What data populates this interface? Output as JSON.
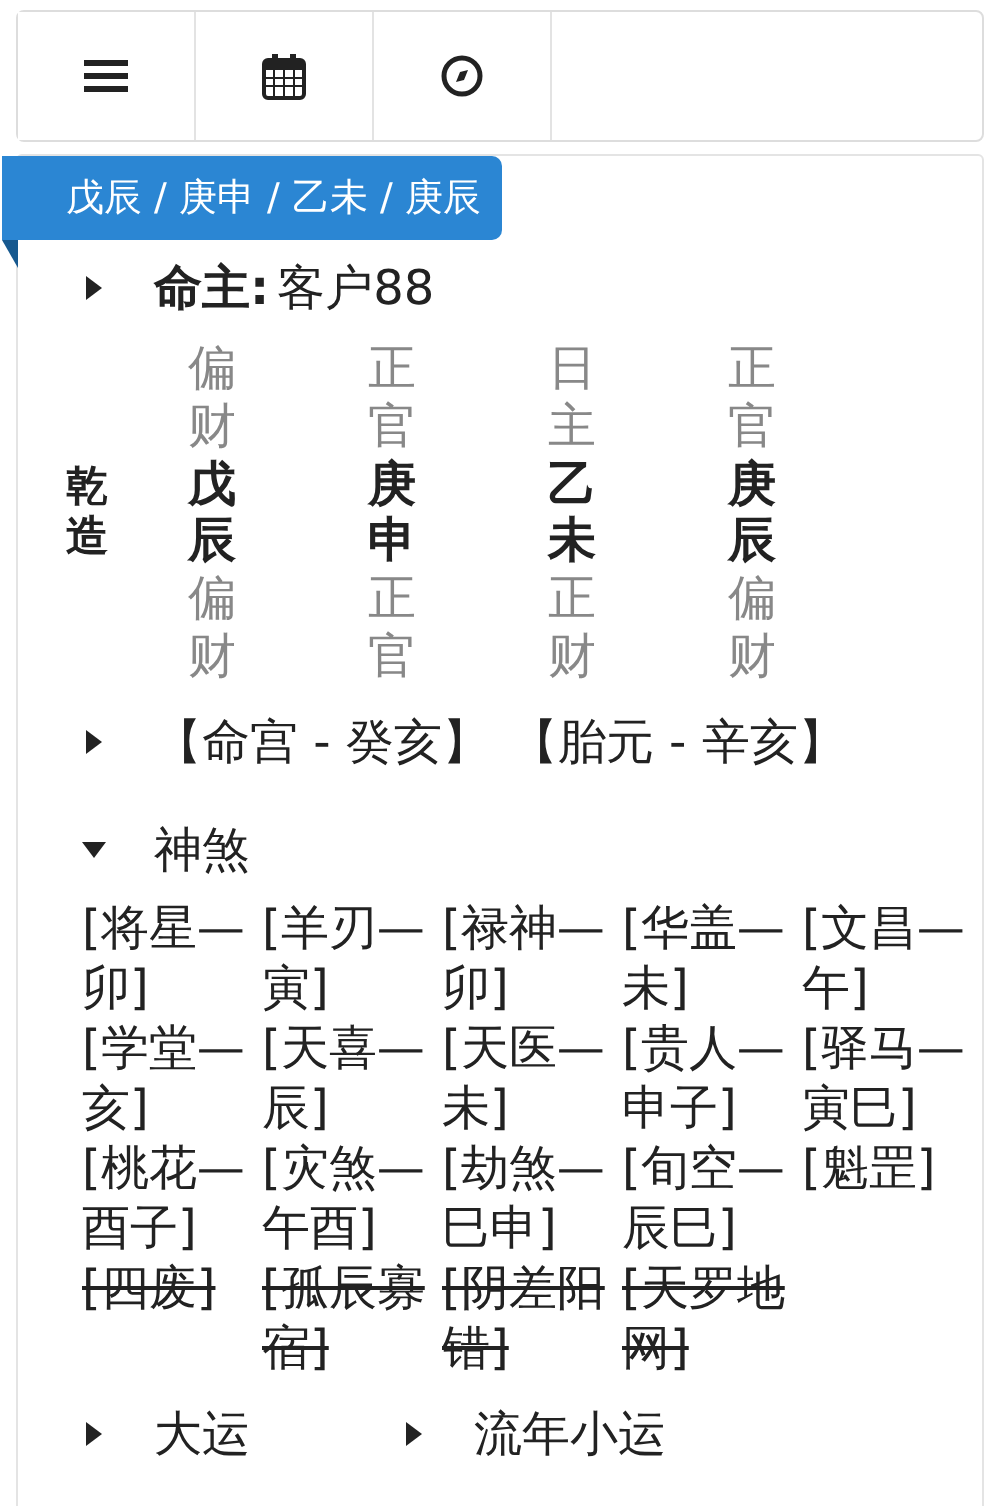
{
  "toolbar": [
    {
      "kind": "menu"
    },
    {
      "kind": "calendar"
    },
    {
      "kind": "compass"
    }
  ],
  "ribbon": "戊辰 / 庚申 / 乙未 / 庚辰",
  "owner": {
    "expanded": false,
    "label": "命主:",
    "value": "客户88"
  },
  "chart": {
    "label": "乾造",
    "pillars": [
      {
        "top": "偏财",
        "stem": "戊",
        "branch": "辰",
        "bottom": "偏财"
      },
      {
        "top": "正官",
        "stem": "庚",
        "branch": "申",
        "bottom": "正官"
      },
      {
        "top": "日主",
        "stem": "乙",
        "branch": "未",
        "bottom": "正财"
      },
      {
        "top": "正官",
        "stem": "庚",
        "branch": "辰",
        "bottom": "偏财"
      }
    ]
  },
  "palace": {
    "expanded": false,
    "items": [
      "【命宫 - 癸亥】",
      "【胎元 - 辛亥】"
    ]
  },
  "shensha": {
    "expanded": true,
    "title": "神煞",
    "items": [
      {
        "text": "[将星—卯]",
        "struck": false
      },
      {
        "text": "[羊刃—寅]",
        "struck": false
      },
      {
        "text": "[禄神—卯]",
        "struck": false
      },
      {
        "text": "[华盖—未]",
        "struck": false
      },
      {
        "text": "[文昌—午]",
        "struck": false
      },
      {
        "text": "[学堂—亥]",
        "struck": false
      },
      {
        "text": "[天喜—辰]",
        "struck": false
      },
      {
        "text": "[天医—未]",
        "struck": false
      },
      {
        "text": "[贵人—申子]",
        "struck": false
      },
      {
        "text": "[驿马—寅巳]",
        "struck": false
      },
      {
        "text": "[桃花—酉子]",
        "struck": false
      },
      {
        "text": "[灾煞—午酉]",
        "struck": false
      },
      {
        "text": "[劫煞—巳申]",
        "struck": false
      },
      {
        "text": "[旬空—辰巳]",
        "struck": false
      },
      {
        "text": "[魁罡]",
        "struck": false
      },
      {
        "text": "[四废]",
        "struck": true
      },
      {
        "text": "[孤辰寡宿]",
        "struck": true
      },
      {
        "text": "[阴差阳错]",
        "struck": true
      },
      {
        "text": "[天罗地网]",
        "struck": true
      }
    ]
  },
  "footer": [
    {
      "label": "大运",
      "expanded": false
    },
    {
      "label": "流年小运",
      "expanded": false
    }
  ]
}
